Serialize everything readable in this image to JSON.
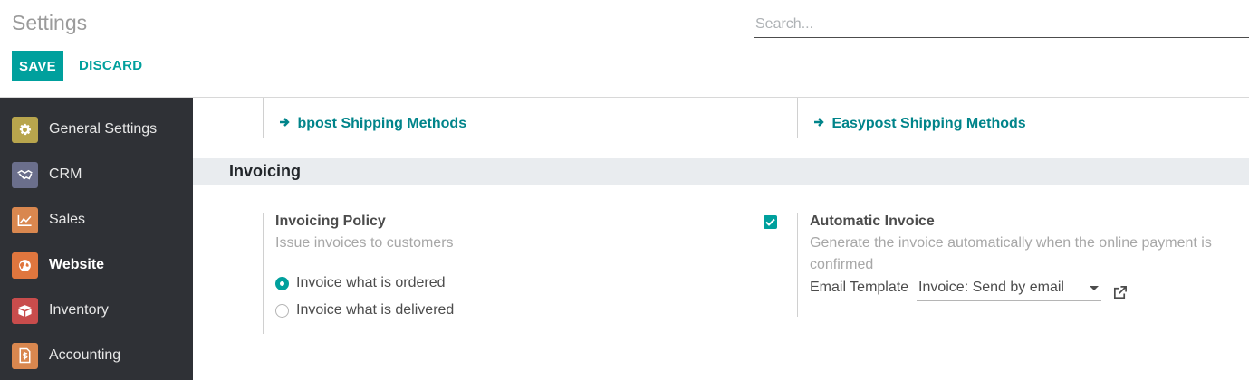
{
  "control_panel": {
    "title": "Settings",
    "search_placeholder": "Search...",
    "save_label": "SAVE",
    "discard_label": "DISCARD"
  },
  "sidebar": {
    "items": [
      {
        "label": "General Settings",
        "icon": "gear-icon",
        "color": "#b8a54d"
      },
      {
        "label": "CRM",
        "icon": "handshake-icon",
        "color": "#6b6f8c"
      },
      {
        "label": "Sales",
        "icon": "chart-trend-icon",
        "color": "#d9874f"
      },
      {
        "label": "Website",
        "icon": "globe-icon",
        "color": "#e0763e"
      },
      {
        "label": "Inventory",
        "icon": "box-icon",
        "color": "#c84c4c"
      },
      {
        "label": "Accounting",
        "icon": "invoice-dollar-icon",
        "color": "#d9874f"
      }
    ]
  },
  "shipping": {
    "bpost_link": "bpost Shipping Methods",
    "easypost_link": "Easypost Shipping Methods"
  },
  "invoicing": {
    "section_title": "Invoicing",
    "policy_title": "Invoicing Policy",
    "policy_desc": "Issue invoices to customers",
    "option_ordered": "Invoice what is ordered",
    "option_delivered": "Invoice what is delivered",
    "auto_title": "Automatic Invoice",
    "auto_desc": "Generate the invoice automatically when the online payment is confirmed",
    "email_template_label": "Email Template",
    "email_template_value": "Invoice: Send by email"
  },
  "colors": {
    "accent": "#00a09d",
    "link": "#00848a",
    "sidebar_bg": "#2f3136"
  }
}
